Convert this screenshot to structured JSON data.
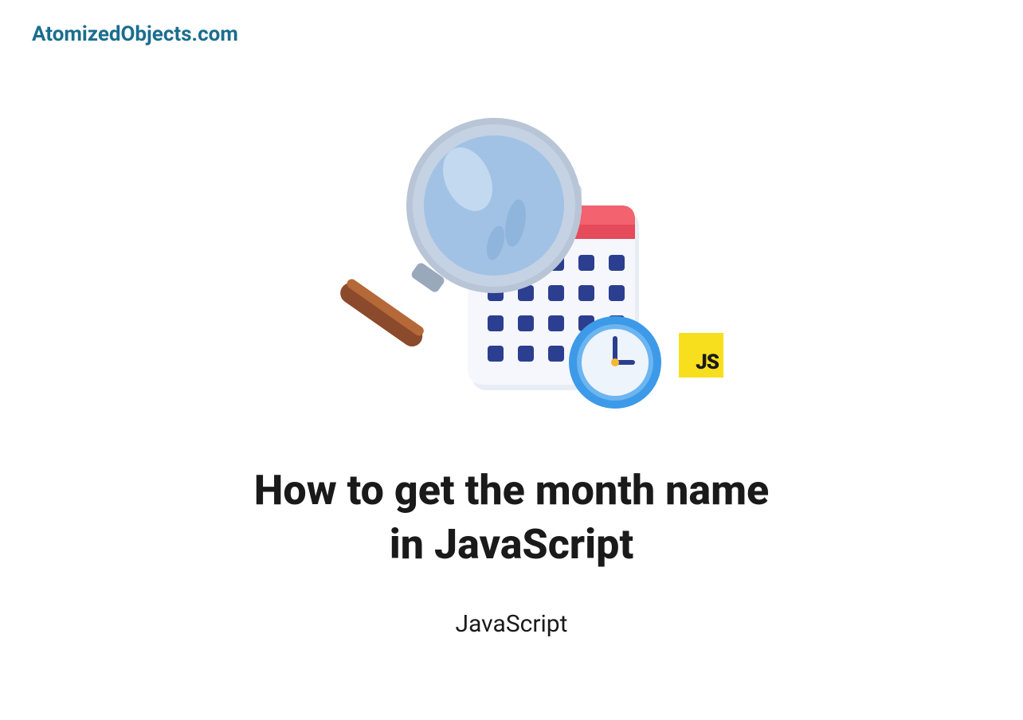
{
  "site_name": "AtomizedObjects.com",
  "title_line1": "How to get the month name",
  "title_line2": "in JavaScript",
  "category": "JavaScript",
  "js_badge": "JS"
}
